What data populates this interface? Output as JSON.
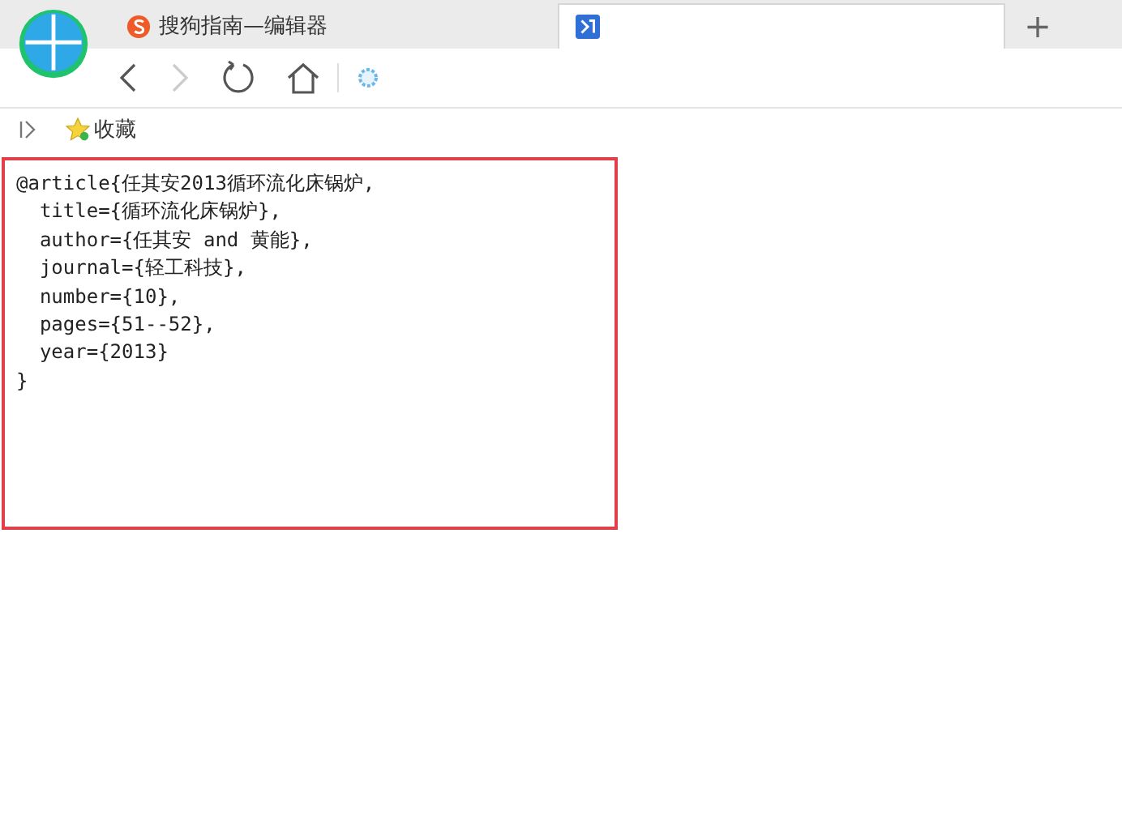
{
  "tabs": [
    {
      "title": "搜狗指南—编辑器",
      "selected": false
    },
    {
      "selected": true
    }
  ],
  "new_tab": "+",
  "bookmarks": {
    "label": "收藏"
  },
  "editor": {
    "lines": [
      "@article{任其安2013循环流化床锅炉,",
      "  title={循环流化床锅炉},",
      "  author={任其安 and 黄能},",
      "  journal={轻工科技},",
      "  number={10},",
      "  pages={51--52},",
      "  year={2013}",
      "}"
    ]
  }
}
